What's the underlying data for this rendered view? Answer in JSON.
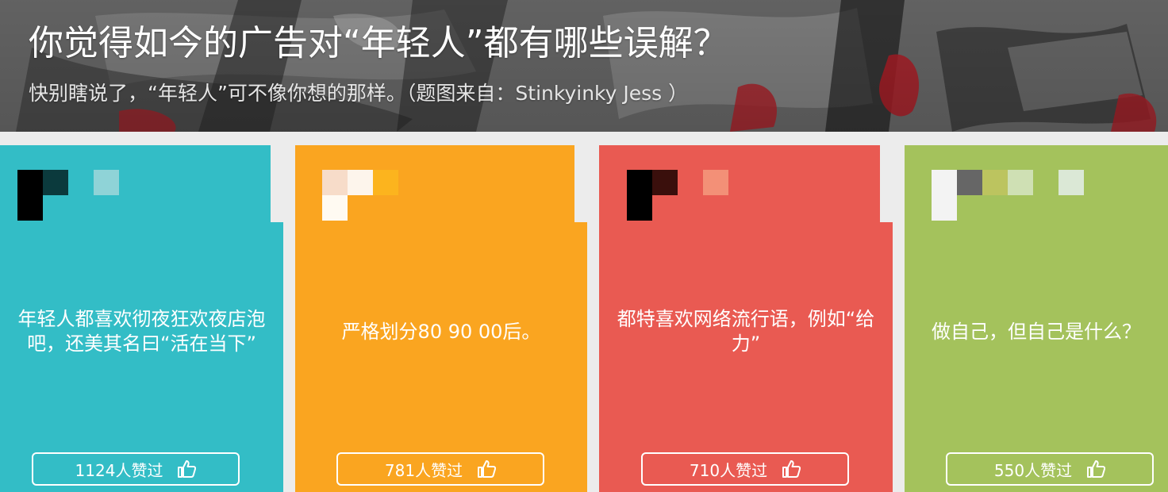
{
  "header": {
    "title": "你觉得如今的广告对“年轻人”都有哪些误解？",
    "subtitle": "快别瞎说了，“年轻人”可不像你想的那样。（题图来自：Stinkyinky Jess ）"
  },
  "cards": [
    {
      "color": "#33bdc6",
      "text": "年轻人都喜欢彻夜狂欢夜店泡吧，还美其名曰“活在当下”",
      "likes_label": "1124人赞过"
    },
    {
      "color": "#faa520",
      "text": "严格划分80 90 00后。",
      "likes_label": "781人赞过"
    },
    {
      "color": "#e95a52",
      "text": "都特喜欢网络流行语，例如“给力”",
      "likes_label": "710人赞过"
    },
    {
      "color": "#a4c25c",
      "text": "做自己，但自己是什么？",
      "likes_label": "550人赞过"
    }
  ],
  "icons": {
    "like": "thumbs-up-icon",
    "avatar": "pixel-avatar-icon"
  }
}
